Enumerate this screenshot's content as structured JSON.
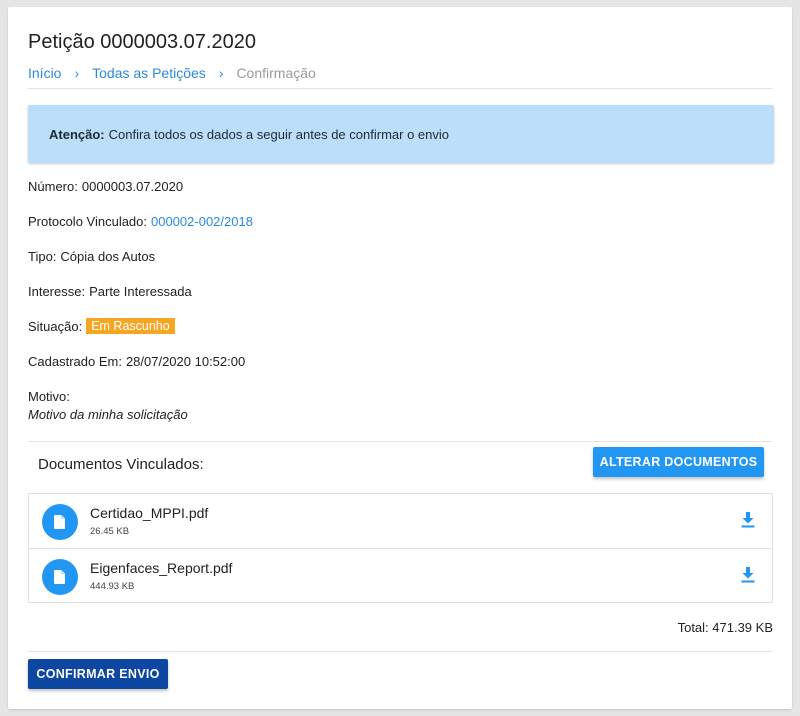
{
  "page": {
    "title": "Petição 0000003.07.2020"
  },
  "breadcrumb": {
    "items": [
      {
        "label": "Início"
      },
      {
        "label": "Todas as Petições"
      },
      {
        "label": "Confirmação"
      }
    ],
    "separator": "›"
  },
  "alert": {
    "strong": "Atenção:",
    "text": "Confira todos os dados a seguir antes de confirmar o envio"
  },
  "fields": {
    "numero": {
      "label": "Número:",
      "value": "0000003.07.2020"
    },
    "protocolo": {
      "label": "Protocolo Vinculado:",
      "value": "000002-002/2018"
    },
    "tipo": {
      "label": "Tipo:",
      "value": "Cópia dos Autos"
    },
    "interesse": {
      "label": "Interesse:",
      "value": "Parte Interessada"
    },
    "situacao": {
      "label": "Situação:",
      "value": "Em Rascunho"
    },
    "cadastrado": {
      "label": "Cadastrado Em:",
      "value": "28/07/2020 10:52:00"
    },
    "motivo": {
      "label": "Motivo:",
      "value": "Motivo da minha solicitação"
    }
  },
  "documents": {
    "title": "Documentos Vinculados:",
    "alter_button": "ALTERAR DOCUMENTOS",
    "items": [
      {
        "name": "Certidao_MPPI.pdf",
        "size": "26.45 KB",
        "icon": "file-icon",
        "action_icon": "download-icon"
      },
      {
        "name": "Eigenfaces_Report.pdf",
        "size": "444.93 KB",
        "icon": "file-icon",
        "action_icon": "download-icon"
      }
    ],
    "total": "Total: 471.39 KB"
  },
  "actions": {
    "confirm_button": "CONFIRMAR ENVIO"
  },
  "colors": {
    "primary": "#2196f3",
    "link": "#2a8ae0",
    "alert_bg": "#bbdefb",
    "badge": "#f5a623",
    "confirm": "#0d47a1"
  }
}
